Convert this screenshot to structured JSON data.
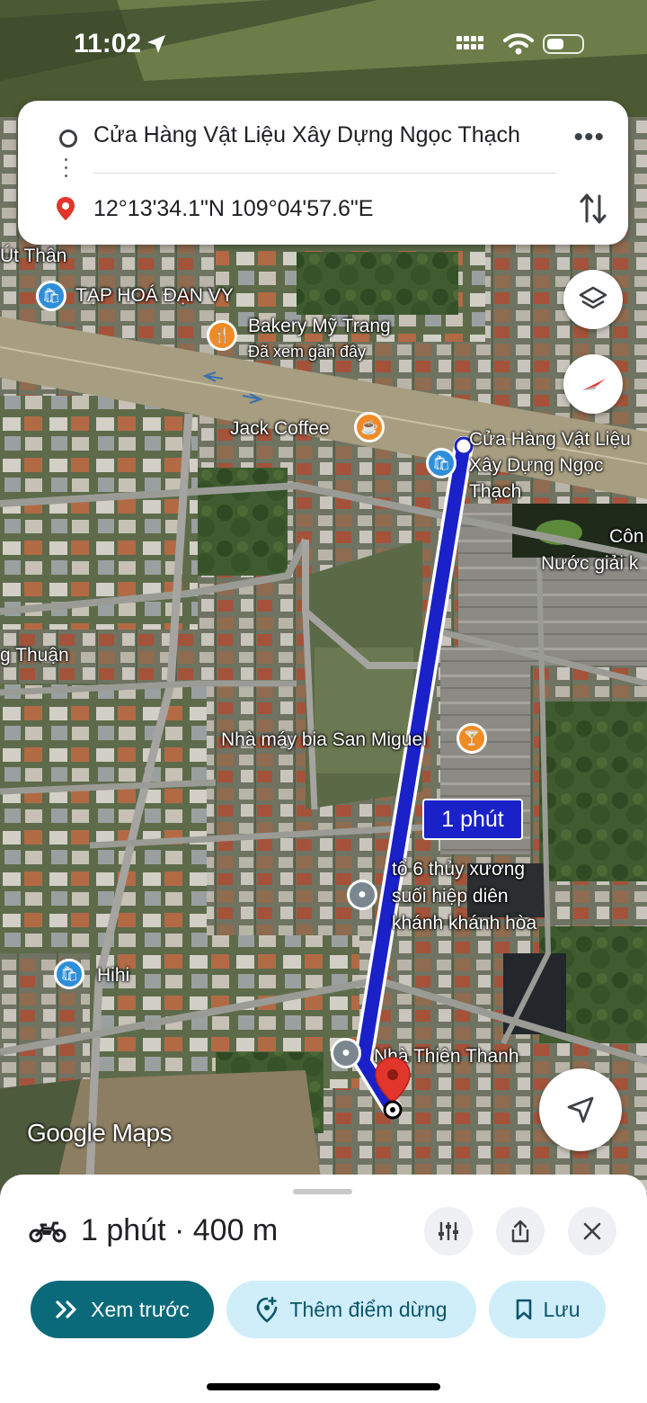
{
  "status_bar": {
    "time": "11:02"
  },
  "route_card": {
    "origin": "Cửa Hàng Vật Liệu Xây Dựng Ngọc Thạch",
    "destination": "12°13'34.1\"N 109°04'57.6\"E"
  },
  "map": {
    "route_time_badge": "1 phút",
    "watermark": "Google Maps",
    "labels": {
      "ut_than": "Út Thân",
      "tap_hoa": "TẠP HOÁ ĐẠN VY",
      "bakery": "Bakery Mỹ Trang",
      "bakery_sub": "Đã xem gần đây",
      "jack_coffee": "Jack Coffee",
      "origin_line1": "Cửa Hàng Vật Liệu",
      "origin_line2": "Xây Dựng Ngọc",
      "origin_line3": "Thạch",
      "con": "Côn",
      "nuoc_giai": "Nước giải k",
      "g_thuan": "g Thuận",
      "nha_may_bia": "Nhà máy bia San Miguel",
      "to6_line1": "tổ 6 thủy xương",
      "to6_line2": "suối hiệp diên",
      "to6_line3": "khánh khánh hòa",
      "hihi": "Hihi",
      "nha_thien_thanh": "Nhà Thiên Thanh"
    },
    "icons": {
      "layers": "layers-icon",
      "compass": "compass-icon",
      "my_location": "navigation-arrow-icon"
    }
  },
  "bottom_sheet": {
    "summary": "1 phút · 400 m",
    "preview_label": "Xem trước",
    "add_stop_label": "Thêm điểm dừng",
    "save_label": "Lưu"
  },
  "colors": {
    "route": "#1a21c8",
    "primary_button": "#0b6a7a",
    "secondary_button": "#cfeefa",
    "poi_shopping": "#2f8ed8",
    "poi_food": "#f08a24",
    "poi_generic": "#7b8790",
    "destination_pin": "#e2352b"
  }
}
